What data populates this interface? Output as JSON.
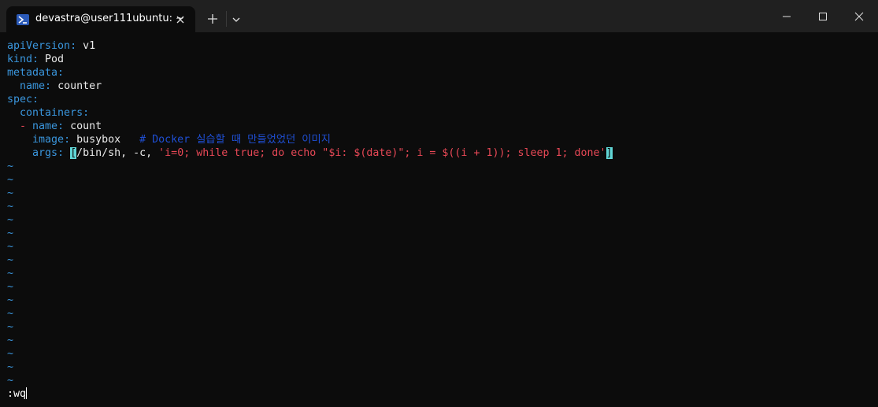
{
  "titlebar": {
    "tab_title": "devastra@user111ubuntu: ~",
    "tab_icon": "powershell-icon",
    "new_tab_icon": "plus-icon",
    "dropdown_icon": "chevron-down-icon",
    "window_controls": [
      "minimize-icon",
      "maximize-icon",
      "close-icon"
    ]
  },
  "editor": {
    "lines": [
      {
        "key": "apiVersion",
        "sep": ": ",
        "value": "v1"
      },
      {
        "key": "kind",
        "sep": ": ",
        "value": "Pod"
      },
      {
        "key": "metadata",
        "sep": ":",
        "value": ""
      },
      {
        "indent": "  ",
        "key": "name",
        "sep": ": ",
        "value": "counter"
      },
      {
        "key": "spec",
        "sep": ":",
        "value": ""
      },
      {
        "indent": "  ",
        "key": "containers",
        "sep": ":",
        "value": ""
      },
      {
        "indent": "  ",
        "dash": "- ",
        "key": "name",
        "sep": ": ",
        "value": "count"
      },
      {
        "indent": "    ",
        "key": "image",
        "sep": ": ",
        "value": "busybox",
        "comment": "   # Docker 실습할 때 만들었었던 이미지"
      },
      {
        "indent": "    ",
        "key": "args",
        "sep": ": ",
        "open_bracket": "[",
        "value": "/bin/sh, -c, ",
        "string": "'i=0; while true; do echo \"$i: $(date)\"; i = $((i + 1)); sleep 1; done'",
        "close_bracket": "]"
      }
    ],
    "tilde": "~",
    "tilde_count": 17,
    "command": ":wq"
  },
  "colors": {
    "key": "#3a96dd",
    "string": "#e74856",
    "comment": "#1f4fd4",
    "background": "#0c0c0c",
    "titlebar": "#202020"
  }
}
